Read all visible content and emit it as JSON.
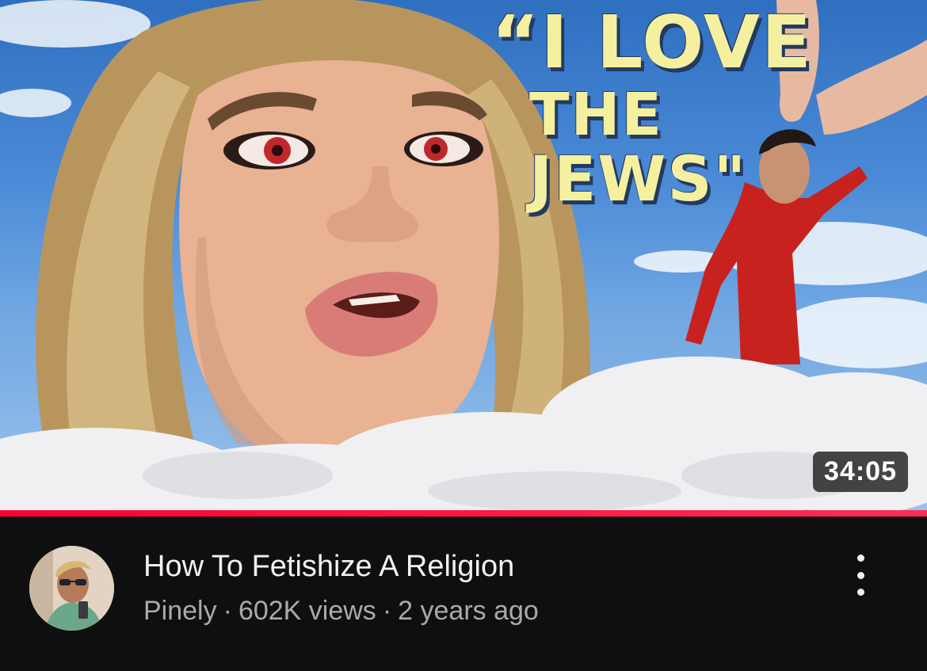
{
  "video": {
    "thumbnail_text_line1": "“I LOVE",
    "thumbnail_text_line2": "THE",
    "thumbnail_text_line3": "JEWS\"",
    "duration": "34:05",
    "watch_progress_fraction": 1.0,
    "title": "How To Fetishize A Religion",
    "channel": "Pinely",
    "separator": "·",
    "views": "602K views",
    "age": "2 years ago"
  },
  "icons": {
    "menu": "more-vert-icon",
    "avatar": "channel-avatar"
  },
  "colors": {
    "background": "#0f0f0f",
    "title": "#f1f1f1",
    "subtitle": "#aaaaaa",
    "progress": "#ff0033",
    "thumbnail_text": "#f5efa0"
  }
}
